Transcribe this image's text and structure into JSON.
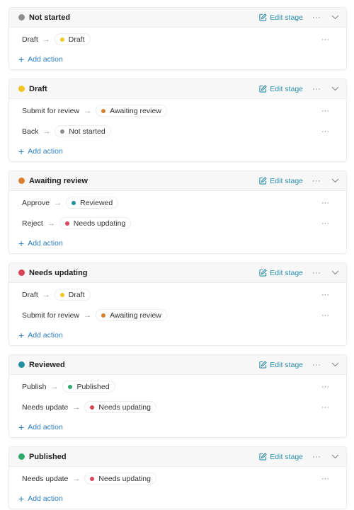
{
  "labels": {
    "edit_stage": "Edit stage",
    "add_action": "Add action",
    "more": "···",
    "arrow": "→"
  },
  "stages": [
    {
      "name": "Not started",
      "color": "#8e8e8e",
      "actions": [
        {
          "label": "Draft",
          "target": "Draft",
          "target_color": "#f3c623"
        }
      ]
    },
    {
      "name": "Draft",
      "color": "#f3c623",
      "actions": [
        {
          "label": "Submit for review",
          "target": "Awaiting review",
          "target_color": "#d97f2e"
        },
        {
          "label": "Back",
          "target": "Not started",
          "target_color": "#8e8e8e"
        }
      ]
    },
    {
      "name": "Awaiting review",
      "color": "#d97f2e",
      "actions": [
        {
          "label": "Approve",
          "target": "Reviewed",
          "target_color": "#23909f"
        },
        {
          "label": "Reject",
          "target": "Needs updating",
          "target_color": "#d9435a"
        }
      ]
    },
    {
      "name": "Needs updating",
      "color": "#d9435a",
      "actions": [
        {
          "label": "Draft",
          "target": "Draft",
          "target_color": "#f3c623"
        },
        {
          "label": "Submit for review",
          "target": "Awaiting review",
          "target_color": "#d97f2e"
        }
      ]
    },
    {
      "name": "Reviewed",
      "color": "#23909f",
      "actions": [
        {
          "label": "Publish",
          "target": "Published",
          "target_color": "#2fab6e"
        },
        {
          "label": "Needs update",
          "target": "Needs updating",
          "target_color": "#d9435a"
        }
      ]
    },
    {
      "name": "Published",
      "color": "#2fab6e",
      "actions": [
        {
          "label": "Needs update",
          "target": "Needs updating",
          "target_color": "#d9435a"
        }
      ]
    }
  ]
}
